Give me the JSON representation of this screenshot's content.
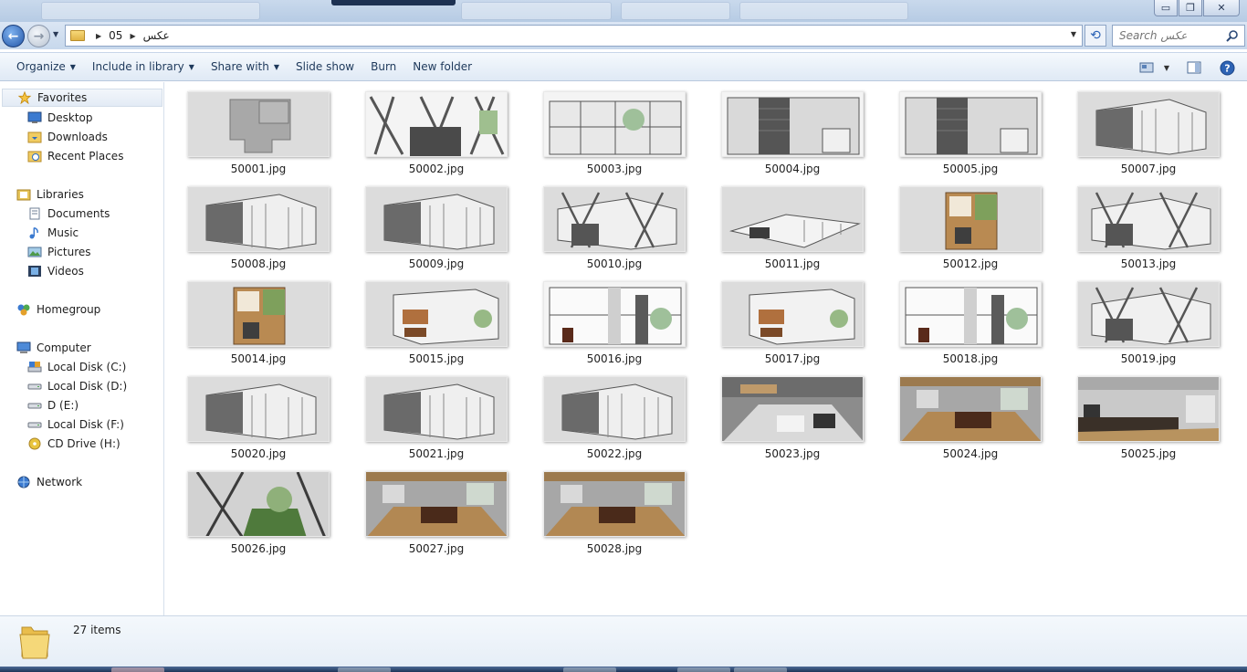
{
  "window": {
    "minimize_label": "▭",
    "maximize_label": "❐",
    "close_label": "✕"
  },
  "address": {
    "crumbs": [
      "05",
      "عکس"
    ],
    "search_placeholder": "Search عکس"
  },
  "toolbar": {
    "organize": "Organize",
    "include_in_library": "Include in library",
    "share_with": "Share with",
    "slide_show": "Slide show",
    "burn": "Burn",
    "new_folder": "New folder"
  },
  "sidebar": {
    "favorites": "Favorites",
    "desktop": "Desktop",
    "downloads": "Downloads",
    "recent_places": "Recent Places",
    "libraries": "Libraries",
    "documents": "Documents",
    "music": "Music",
    "pictures": "Pictures",
    "videos": "Videos",
    "homegroup": "Homegroup",
    "computer": "Computer",
    "local_disk_c": "Local Disk (C:)",
    "local_disk_d": "Local Disk (D:)",
    "d_e": "D (E:)",
    "local_disk_f": "Local Disk (F:)",
    "cd_drive_h": "CD Drive (H:)",
    "network": "Network"
  },
  "files": [
    {
      "name": "50001.jpg",
      "kind": "plan-gray"
    },
    {
      "name": "50002.jpg",
      "kind": "elevation-lines"
    },
    {
      "name": "50003.jpg",
      "kind": "elevation-glass"
    },
    {
      "name": "50004.jpg",
      "kind": "elevation-dark"
    },
    {
      "name": "50005.jpg",
      "kind": "elevation-dark"
    },
    {
      "name": "50007.jpg",
      "kind": "perspective"
    },
    {
      "name": "50008.jpg",
      "kind": "perspective"
    },
    {
      "name": "50009.jpg",
      "kind": "perspective"
    },
    {
      "name": "50010.jpg",
      "kind": "perspective-lines"
    },
    {
      "name": "50011.jpg",
      "kind": "cutaway"
    },
    {
      "name": "50012.jpg",
      "kind": "plan-color"
    },
    {
      "name": "50013.jpg",
      "kind": "perspective-lines"
    },
    {
      "name": "50014.jpg",
      "kind": "plan-color"
    },
    {
      "name": "50015.jpg",
      "kind": "section-color"
    },
    {
      "name": "50016.jpg",
      "kind": "section-flat"
    },
    {
      "name": "50017.jpg",
      "kind": "section-color"
    },
    {
      "name": "50018.jpg",
      "kind": "section-flat"
    },
    {
      "name": "50019.jpg",
      "kind": "perspective-lines"
    },
    {
      "name": "50020.jpg",
      "kind": "perspective"
    },
    {
      "name": "50021.jpg",
      "kind": "perspective"
    },
    {
      "name": "50022.jpg",
      "kind": "perspective"
    },
    {
      "name": "50023.jpg",
      "kind": "interior"
    },
    {
      "name": "50024.jpg",
      "kind": "interior-wood"
    },
    {
      "name": "50025.jpg",
      "kind": "interior-kitchen"
    },
    {
      "name": "50026.jpg",
      "kind": "stair-green"
    },
    {
      "name": "50027.jpg",
      "kind": "interior-wood"
    },
    {
      "name": "50028.jpg",
      "kind": "interior-wood"
    }
  ],
  "status": {
    "item_count": "27 items"
  }
}
